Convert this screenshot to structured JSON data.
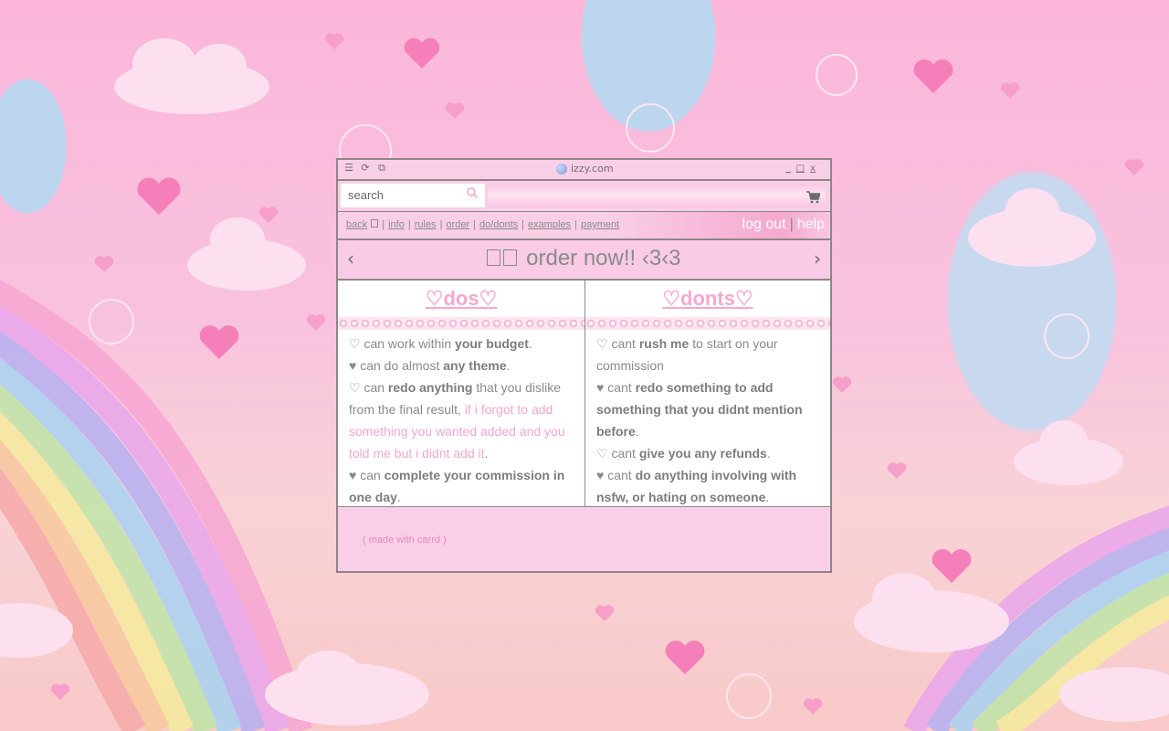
{
  "window": {
    "title": "izzy.com",
    "controls": [
      "_",
      "□",
      "x"
    ]
  },
  "search": {
    "placeholder": "search"
  },
  "nav": {
    "links": [
      "back",
      "info",
      "rules",
      "order",
      "do/donts",
      "examples",
      "payment"
    ],
    "logout": "log out",
    "separator": "|",
    "help": "help"
  },
  "header": {
    "title": "order now!! ‹3‹3"
  },
  "dos": {
    "title": "♡dos♡",
    "items": [
      {
        "bullet": "♡",
        "pre": "can work within ",
        "bold": "your budget",
        "post": "."
      },
      {
        "bullet": "♥",
        "pre": "can do almost ",
        "bold": "any theme",
        "post": "."
      },
      {
        "bullet": "♡",
        "pre": "can ",
        "bold": "redo anything",
        "post": " that you dislike from the final result, ",
        "pink": "if i forgot to add something you wanted added and you told me but i didnt add it",
        "end": "."
      },
      {
        "bullet": "♥",
        "pre": "can ",
        "bold": "complete your commission in one day",
        "post": "."
      }
    ]
  },
  "donts": {
    "title": "♡donts♡",
    "items": [
      {
        "bullet": "♡",
        "pre": "cant ",
        "bold": "rush me",
        "post": " to start on your commission"
      },
      {
        "bullet": "♥",
        "pre": "cant ",
        "bold": "redo something to add something that you didnt mention before",
        "post": "."
      },
      {
        "bullet": "♡",
        "pre": "cant ",
        "bold": "give you any refunds",
        "post": "."
      },
      {
        "bullet": "♥",
        "pre": "cant ",
        "bold": "do anything involving with nsfw, or hating on someone",
        "post": "."
      }
    ]
  },
  "footer": {
    "text": "( made with carrd )"
  },
  "colors": {
    "accent_pink": "#f6a8d0",
    "border": "#8f8588",
    "text_gray": "#8a8a8a"
  },
  "icons": [
    "menu-icon",
    "refresh-icon",
    "external-link-icon",
    "globe-icon",
    "search-icon",
    "cart-icon",
    "chevron-left-icon",
    "chevron-right-icon"
  ]
}
